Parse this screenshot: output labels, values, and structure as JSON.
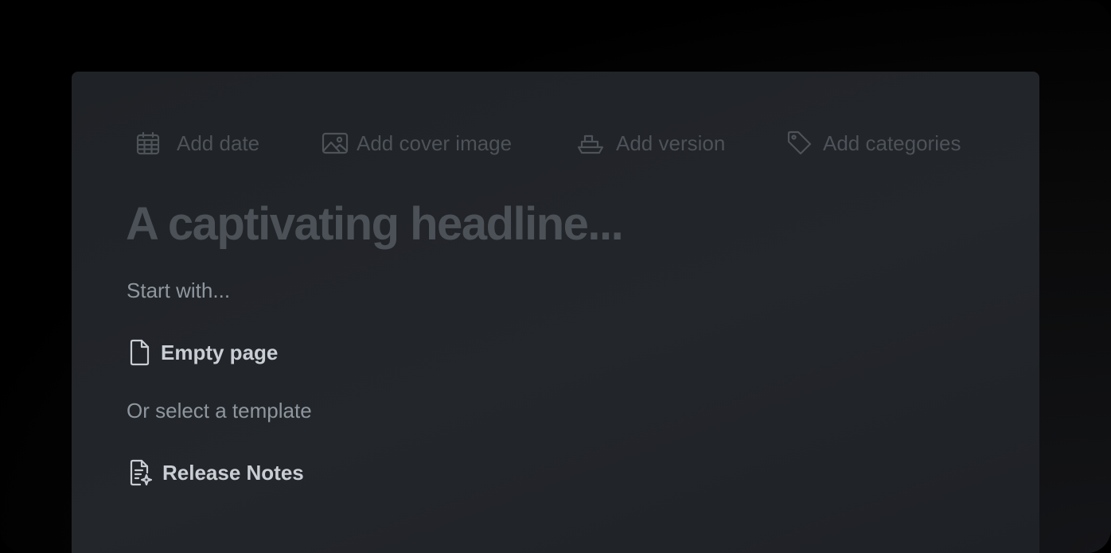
{
  "toolbar": {
    "add_date": "Add date",
    "add_cover_image": "Add cover image",
    "add_version": "Add version",
    "add_categories": "Add categories"
  },
  "editor": {
    "headline_placeholder": "A captivating headline...",
    "start_with": "Start with...",
    "empty_page": "Empty page",
    "or_select_template": "Or select a template",
    "templates": [
      {
        "label": "Release Notes",
        "icon": "document-sparkle-icon"
      }
    ]
  },
  "icons": {
    "date": "calendar-icon",
    "cover": "image-icon",
    "version": "ship-icon",
    "categories": "tag-icon",
    "empty_page": "file-icon"
  },
  "colors": {
    "background": "#000000",
    "card": "#212428",
    "muted_text": "#4d5359",
    "secondary_text": "#8e969e",
    "primary_text": "#c9ced4"
  }
}
